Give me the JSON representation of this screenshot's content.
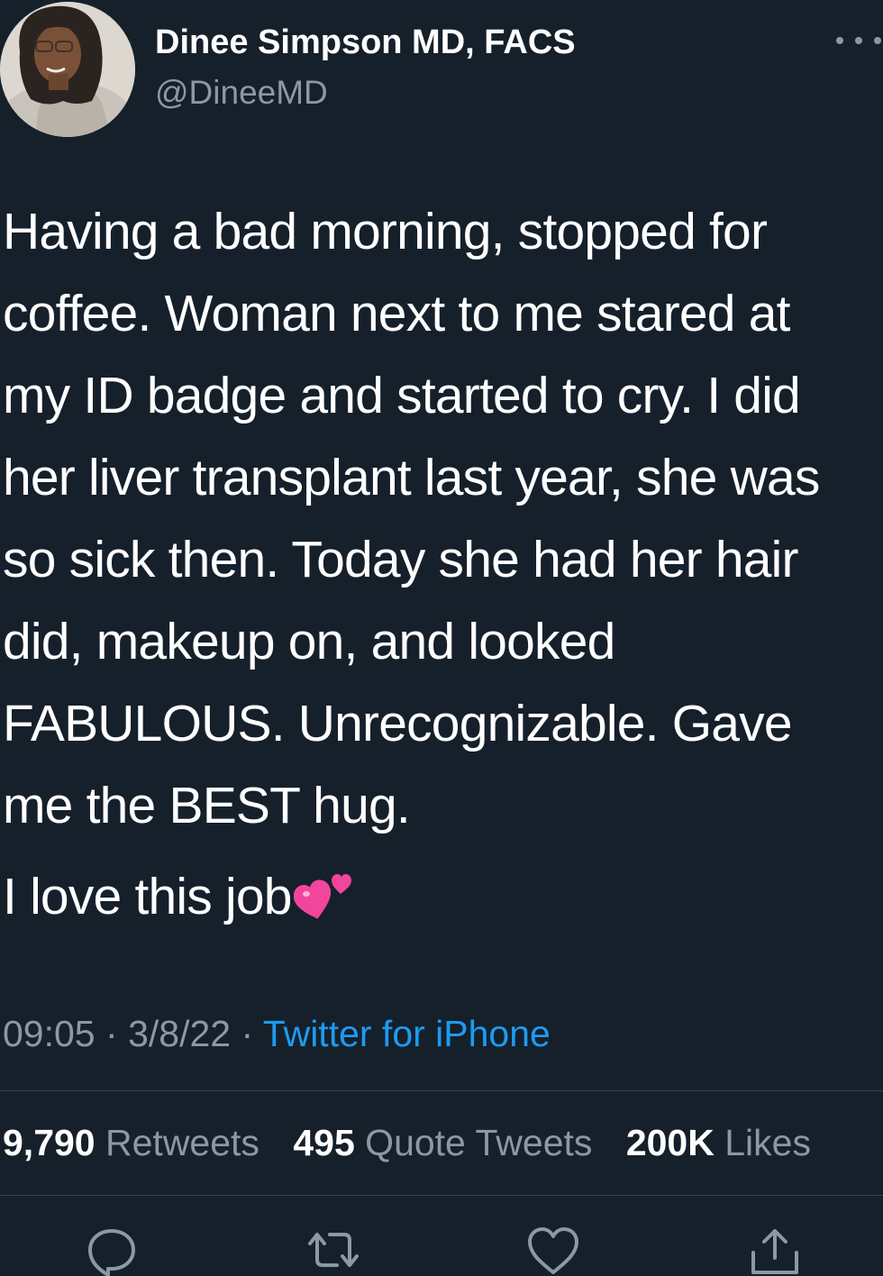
{
  "author": {
    "display_name": "Dinee Simpson MD, FACS",
    "handle": "@DineeMD"
  },
  "tweet": {
    "lines": [
      "Having a bad morning, stopped for",
      "coffee. Woman next to me stared at",
      "my ID badge and started to cry. I did",
      "her liver transplant last year, she was",
      "so sick then. Today she had her hair",
      "did, makeup on, and looked",
      "FABULOUS.  Unrecognizable. Gave",
      "me the BEST hug."
    ],
    "closing": "I love this job",
    "closing_emoji": "two-hearts-icon"
  },
  "meta": {
    "time": "09:05",
    "date": "3/8/22",
    "separator": "·",
    "source": "Twitter for iPhone"
  },
  "stats": {
    "retweets_count": "9,790",
    "retweets_label": "Retweets",
    "quotes_count": "495",
    "quotes_label": "Quote Tweets",
    "likes_count": "200K",
    "likes_label": "Likes"
  },
  "actions": {
    "icons": [
      "reply-icon",
      "retweet-icon",
      "like-icon",
      "share-icon"
    ]
  },
  "colors": {
    "background": "#15202b",
    "text": "#ffffff",
    "muted": "#8b98a5",
    "link": "#1d9bf0",
    "divider": "#38444d",
    "emoji_pink": "#f2459c"
  }
}
